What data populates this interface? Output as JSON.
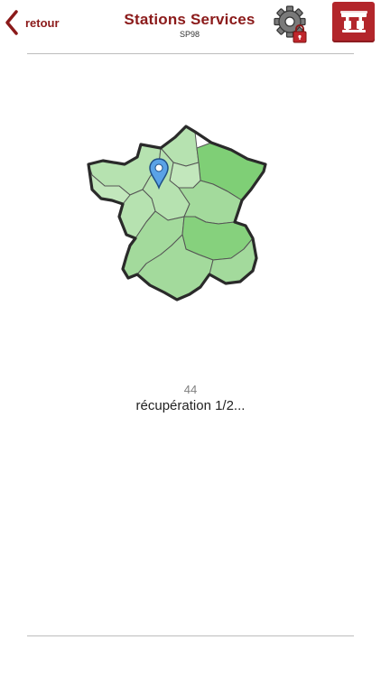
{
  "header": {
    "back_label": "retour",
    "title": "Stations Services",
    "subtitle": "SP98"
  },
  "icons": {
    "back": "chevron-left-icon",
    "settings": "gear-lock-icon",
    "station": "fuel-pump-icon",
    "map": "france-map-icon",
    "pin": "map-pin-icon"
  },
  "loading": {
    "count": "44",
    "status": "récupération 1/2..."
  },
  "colors": {
    "accent": "#8b1a1a",
    "button": "#b3262b",
    "map_light": "#b6e2b0",
    "map_mid": "#9ed896",
    "map_dark": "#7fcf76",
    "pin": "#4a90d9"
  }
}
